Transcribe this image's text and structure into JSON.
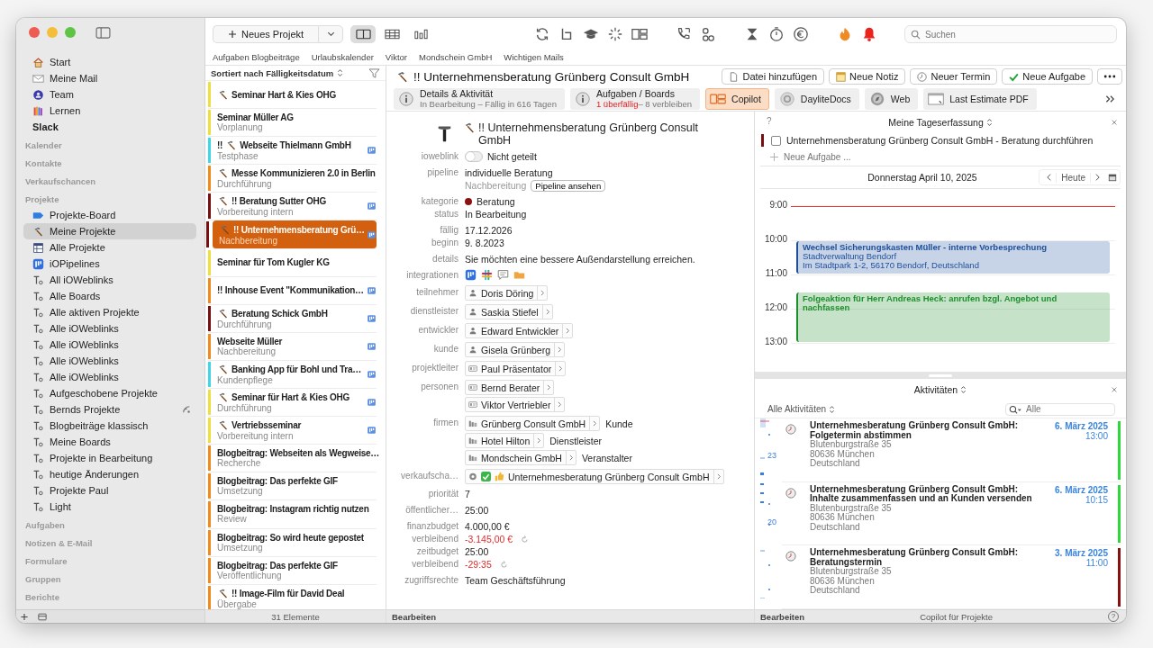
{
  "sidebar": {
    "favorites": [
      {
        "label": "Start"
      },
      {
        "label": "Meine Mail"
      },
      {
        "label": "Team"
      },
      {
        "label": "Lernen"
      },
      {
        "label": "Slack"
      }
    ],
    "sections_before": [
      "Kalender",
      "Kontakte",
      "Verkaufschancen"
    ],
    "projects": {
      "label": "Projekte",
      "items": [
        {
          "label": "Projekte-Board",
          "selected": false,
          "shared": false
        },
        {
          "label": "Meine Projekte",
          "selected": true,
          "shared": false
        },
        {
          "label": "Alle Projekte",
          "selected": false,
          "shared": false
        },
        {
          "label": "iOPipelines",
          "selected": false,
          "shared": false
        },
        {
          "label": "All iOWeblinks",
          "selected": false,
          "shared": false
        },
        {
          "label": "Alle Boards",
          "selected": false,
          "shared": false
        },
        {
          "label": "Alle aktiven Projekte",
          "selected": false,
          "shared": false
        },
        {
          "label": "Alle iOWeblinks",
          "selected": false,
          "shared": false
        },
        {
          "label": "Alle iOWeblinks",
          "selected": false,
          "shared": false
        },
        {
          "label": "Alle iOWeblinks",
          "selected": false,
          "shared": false
        },
        {
          "label": "Alle iOWeblinks",
          "selected": false,
          "shared": false
        },
        {
          "label": "Aufgeschobene Projekte",
          "selected": false,
          "shared": false
        },
        {
          "label": "Bernds Projekte",
          "selected": false,
          "shared": true
        },
        {
          "label": "Blogbeiträge klassisch",
          "selected": false,
          "shared": false
        },
        {
          "label": "Meine Boards",
          "selected": false,
          "shared": false
        },
        {
          "label": "Projekte in Bearbeitung",
          "selected": false,
          "shared": false
        },
        {
          "label": "heutige Änderungen",
          "selected": false,
          "shared": false
        },
        {
          "label": "Projekte Paul",
          "selected": false,
          "shared": false
        },
        {
          "label": "Light",
          "selected": false,
          "shared": false
        }
      ]
    },
    "sections_after": [
      "Aufgaben",
      "Notizen & E-Mail",
      "Formulare",
      "Gruppen",
      "Berichte"
    ]
  },
  "toolbar": {
    "new_button": "Neues Projekt",
    "views": [
      {
        "selected": true
      },
      {
        "selected": false
      },
      {
        "selected": false
      }
    ],
    "search": {
      "placeholder": "Suchen"
    }
  },
  "bookmarks": [
    "Aufgaben Blogbeiträge",
    "Urlaubskalender",
    "Viktor",
    "Mondschein GmbH",
    "Wichtigen Mails"
  ],
  "list": {
    "sort": "Sortiert nach Fälligkeitsdatum",
    "footer": "31 Elemente",
    "items": [
      {
        "hammer": true,
        "title": "Seminar Hart & Kies OHG",
        "color": "#ecdf3e",
        "board": false,
        "selected": false
      },
      {
        "hammer": false,
        "title": "Seminar Müller AG",
        "subtitle": "Vorplanung",
        "color": "#ecdf3e",
        "board": false,
        "selected": false
      },
      {
        "pre": "!!",
        "hammer": true,
        "title": "Webseite Thielmann GmbH",
        "subtitle": "Testphase",
        "color": "#3fd6e6",
        "board": true,
        "selected": false
      },
      {
        "hammer": true,
        "title": "Messe Kommunizieren 2.0 in Berlin",
        "subtitle": "Durchführung",
        "color": "#f08a1c",
        "board": false,
        "selected": false
      },
      {
        "hammer": true,
        "title": "!! Beratung Sutter OHG",
        "subtitle": "Vorbereitung intern",
        "color": "#7a0f12",
        "board": true,
        "selected": false
      },
      {
        "hammer": true,
        "title": "!! Unternehmensberatung Grü…",
        "subtitle": "Nachbereitung",
        "color": "#7a0f12",
        "board": true,
        "selected": true
      },
      {
        "hammer": false,
        "title": "Seminar für Tom Kugler KG",
        "color": "#ecdf3e",
        "board": false,
        "selected": false
      },
      {
        "hammer": false,
        "title": "!! Inhouse Event \"Kommunikation…",
        "color": "#f08a1c",
        "board": true,
        "selected": false
      },
      {
        "hammer": true,
        "title": "Beratung Schick GmbH",
        "subtitle": "Durchführung",
        "color": "#7a0f12",
        "board": true,
        "selected": false
      },
      {
        "hammer": false,
        "title": "Webseite Müller",
        "subtitle": "Nachbereitung",
        "color": "#f08a1c",
        "board": true,
        "selected": false
      },
      {
        "hammer": true,
        "title": "Banking App für Bohl und Tra…",
        "subtitle": "Kundenpflege",
        "color": "#3fd6e6",
        "board": true,
        "selected": false
      },
      {
        "hammer": true,
        "title": "Seminar für Hart & Kies OHG",
        "subtitle": "Durchführung",
        "color": "#ecdf3e",
        "board": true,
        "selected": false
      },
      {
        "hammer": true,
        "title": "Vertriebsseminar",
        "subtitle": "Vorbereitung intern",
        "color": "#ecdf3e",
        "board": true,
        "selected": false
      },
      {
        "hammer": false,
        "title": "Blogbeitrag: Webseiten als Wegweise…",
        "subtitle": "Recherche",
        "color": "#f08a1c",
        "board": false,
        "selected": false
      },
      {
        "hammer": false,
        "title": "Blogbeitrag: Das perfekte GIF",
        "subtitle": "Umsetzung",
        "color": "#f08a1c",
        "board": false,
        "selected": false
      },
      {
        "hammer": false,
        "title": "Blogbeitrag: Instagram richtig nutzen",
        "subtitle": "Review",
        "color": "#f08a1c",
        "board": false,
        "selected": false
      },
      {
        "hammer": false,
        "title": "Blogbeitrag: So wird heute gepostet",
        "subtitle": "Umsetzung",
        "color": "#f08a1c",
        "board": false,
        "selected": false
      },
      {
        "hammer": false,
        "title": "Blogbeitrag: Das perfekte GIF",
        "subtitle": "Veröffentlichung",
        "color": "#f08a1c",
        "board": false,
        "selected": false
      },
      {
        "hammer": true,
        "title": "!! Image-Film für David Deal",
        "subtitle": "Übergabe",
        "color": "#f08a1c",
        "board": false,
        "selected": false
      }
    ]
  },
  "header": {
    "title": "!! Unternehmensberatung Grünberg Consult GmbH",
    "buttons": [
      "Datei hinzufügen",
      "Neue Notiz",
      "Neuer Termin",
      "Neue Aufgabe"
    ]
  },
  "tabs": [
    {
      "label": "Details & Aktivität",
      "sub": "In Bearbeitung – Fällig in 616 Tagen",
      "selected": false
    },
    {
      "label": "Aufgaben / Boards",
      "sub_alert": "1 überfällig",
      "sub": "– 8 verbleiben",
      "selected": false
    },
    {
      "label": "Copilot",
      "selected": true
    },
    {
      "label": "DayliteDocs",
      "selected": false
    },
    {
      "label": "Web",
      "selected": false
    },
    {
      "label": "Last Estimate PDF",
      "selected": false
    }
  ],
  "detail": {
    "title": "!! Unternehmensberatung Grünberg Consult GmbH",
    "footer": "Bearbeiten",
    "groups": [
      [
        {
          "kind": "toggle",
          "label": "ioweblink",
          "on": false,
          "text": "Nicht geteilt"
        }
      ],
      [
        {
          "kind": "pipeline",
          "label": "pipeline",
          "value": "individuelle Beratung",
          "stage": "Nachbereitung",
          "button": "Pipeline ansehen"
        }
      ],
      [
        {
          "kind": "category",
          "label": "kategorie",
          "value": "Beratung",
          "color": "#8b1010"
        },
        {
          "kind": "text",
          "label": "status",
          "value": "In Bearbeitung"
        }
      ],
      [
        {
          "kind": "text",
          "label": "fällig",
          "value": "17.12.2026"
        },
        {
          "kind": "text",
          "label": "beginn",
          "value": "9.  8.2023"
        }
      ],
      [
        {
          "kind": "text",
          "label": "details",
          "value": "Sie möchten eine bessere Außendarstellung erreichen."
        }
      ],
      [
        {
          "kind": "integrations",
          "label": "integrationen"
        }
      ],
      [
        {
          "kind": "chips",
          "label": "teilnehmer",
          "chips": [
            {
              "kind": "person",
              "name": "Doris Döring"
            }
          ]
        }
      ],
      [
        {
          "kind": "chips",
          "label": "dienstleister",
          "chips": [
            {
              "kind": "person",
              "name": "Saskia Stiefel"
            }
          ]
        }
      ],
      [
        {
          "kind": "chips",
          "label": "entwickler",
          "chips": [
            {
              "kind": "person",
              "name": "Edward Entwickler"
            }
          ]
        }
      ],
      [
        {
          "kind": "chips",
          "label": "kunde",
          "chips": [
            {
              "kind": "person",
              "name": "Gisela Grünberg"
            }
          ]
        }
      ],
      [
        {
          "kind": "chips",
          "label": "projektleiter",
          "chips": [
            {
              "kind": "user",
              "name": "Paul Präsentator"
            }
          ]
        }
      ],
      [
        {
          "kind": "chips",
          "label": "personen",
          "chips": [
            {
              "kind": "user",
              "name": "Bernd Berater"
            },
            {
              "kind": "user",
              "name": "Viktor Vertriebler"
            }
          ]
        }
      ],
      [
        {
          "kind": "chips",
          "label": "firmen",
          "chips": [
            {
              "kind": "company",
              "name": "Grünberg Consult GmbH",
              "role": "Kunde"
            },
            {
              "kind": "company",
              "name": "Hotel Hilton",
              "role": "Dienstleister"
            },
            {
              "kind": "company",
              "name": "Mondschein GmbH",
              "role": "Veranstalter"
            }
          ]
        }
      ],
      [
        {
          "kind": "chips",
          "label": "verkaufscha…",
          "chips": [
            {
              "kind": "deal",
              "name": "Unternehmesberatung Grünberg Consult GmbH"
            }
          ]
        }
      ],
      [
        {
          "kind": "text",
          "label": "priorität",
          "value": "7"
        }
      ],
      [
        {
          "kind": "text",
          "label": "öffentlicher…",
          "value": "25:00"
        }
      ],
      [
        {
          "kind": "text",
          "label": "finanzbudget",
          "value": "4.000,00 €"
        },
        {
          "kind": "remaining",
          "label": "verbleibend",
          "value": "-3.145,00 €"
        },
        {
          "kind": "text",
          "label": "zeitbudget",
          "value": "25:00"
        },
        {
          "kind": "remaining",
          "label": "verbleibend",
          "value": "-29:35"
        }
      ],
      [
        {
          "kind": "text",
          "label": "zugriffsrechte",
          "value": "Team Geschäftsführung"
        }
      ]
    ]
  },
  "day": {
    "help": "?",
    "title": "Meine Tageserfassung",
    "tasks": [
      {
        "text": "Unternehmensberatung Grünberg Consult GmbH - Beratung durchführen",
        "checked": false,
        "color": "#7a0f12"
      }
    ],
    "new_task": {
      "placeholder": "Neue Aufgabe ..."
    },
    "date": "Donnerstag April 10, 2025",
    "today": "Heute",
    "hours": [
      "9:00",
      "10:00",
      "11:00",
      "12:00",
      "13:00"
    ],
    "events": [
      {
        "title": "Wechsel Sicherungskasten Müller - interne Vorbesprechung",
        "lines": [
          "Stadtverwaltung Bendorf",
          "Im Stadtpark 1-2, 56170 Bendorf, Deutschland"
        ],
        "color": "#1f4f9a"
      },
      {
        "title": "Folgeaktion für Herr Andreas Heck: anrufen bzgl. Angebot und nachfassen",
        "color": "#1d8f2a"
      }
    ]
  },
  "activities": {
    "title": "Aktivitäten",
    "filter": "Alle Aktivitäten",
    "search": {
      "placeholder": "Alle"
    },
    "scrubber": [
      "23",
      "20"
    ],
    "items": [
      {
        "title": "Unternehmesberatung Grünberg Consult GmbH: Folgetermin abstimmen",
        "lines": [
          "Blutenburgstraße 35",
          "80636 München",
          "Deutschland"
        ],
        "date": "6. März 2025",
        "time": "13:00",
        "color": "#2fd83a"
      },
      {
        "title": "Unternehmesberatung Grünberg Consult GmbH: Inhalte zusammenfassen und an Kunden versenden",
        "lines": [
          "Blutenburgstraße 35",
          "80636 München",
          "Deutschland"
        ],
        "date": "6. März 2025",
        "time": "10:15",
        "color": "#2fd83a"
      },
      {
        "title": "Unternehmesberatung Grünberg Consult GmbH: Beratungstermin",
        "lines": [
          "Blutenburgstraße 35",
          "80636 München",
          "Deutschland"
        ],
        "date": "3. März 2025",
        "time": "11:00",
        "color": "#8a1010"
      }
    ]
  },
  "right_footer": {
    "edit": "Bearbeiten",
    "title": "Copilot für Projekte",
    "help": "?"
  }
}
